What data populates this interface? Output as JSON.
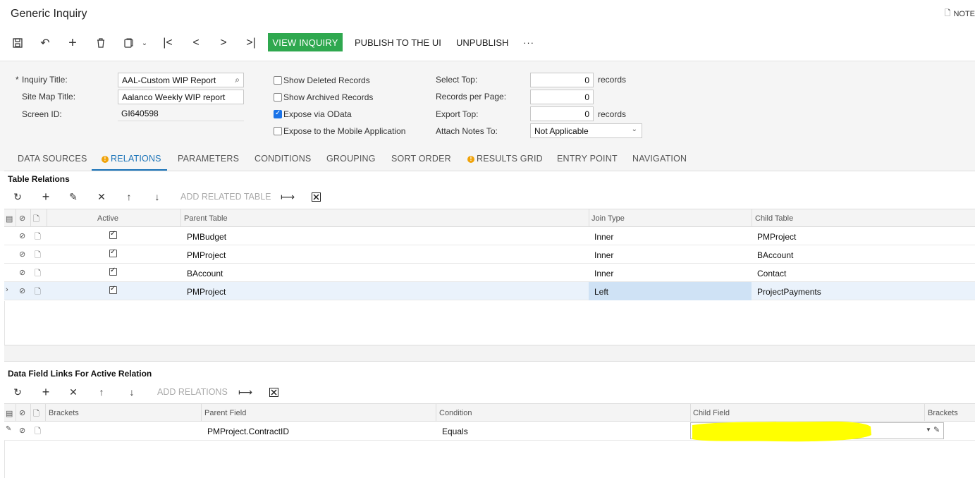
{
  "header": {
    "title": "Generic Inquiry",
    "notes_label": "NOTE"
  },
  "toolbar": {
    "view_inquiry": "VIEW INQUIRY",
    "publish": "PUBLISH TO THE UI",
    "unpublish": "UNPUBLISH",
    "more": "···"
  },
  "form": {
    "inquiry_title_label": "Inquiry Title:",
    "inquiry_title_required": "*",
    "inquiry_title_value": "AAL-Custom WIP Report",
    "site_map_title_label": "Site Map Title:",
    "site_map_title_value": "Aalanco Weekly WIP report",
    "screen_id_label": "Screen ID:",
    "screen_id_value": "GI640598",
    "show_deleted": "Show Deleted Records",
    "show_archived": "Show Archived Records",
    "expose_odata": "Expose via OData",
    "expose_mobile": "Expose to the Mobile Application",
    "select_top_label": "Select Top:",
    "select_top_value": "0",
    "records_per_page_label": "Records per Page:",
    "records_per_page_value": "0",
    "export_top_label": "Export Top:",
    "export_top_value": "0",
    "records_unit": "records",
    "attach_notes_label": "Attach Notes To:",
    "attach_notes_value": "Not Applicable"
  },
  "tabs": [
    "DATA SOURCES",
    "RELATIONS",
    "PARAMETERS",
    "CONDITIONS",
    "GROUPING",
    "SORT ORDER",
    "RESULTS GRID",
    "ENTRY POINT",
    "NAVIGATION"
  ],
  "relations": {
    "title": "Table Relations",
    "add_related": "ADD RELATED TABLE",
    "columns": {
      "active": "Active",
      "parent": "Parent Table",
      "join": "Join Type",
      "child": "Child Table"
    },
    "rows": [
      {
        "parent": "PMBudget",
        "join": "Inner",
        "child": "PMProject"
      },
      {
        "parent": "PMProject",
        "join": "Inner",
        "child": "BAccount"
      },
      {
        "parent": "BAccount",
        "join": "Inner",
        "child": "Contact"
      },
      {
        "parent": "PMProject",
        "join": "Left",
        "child": "ProjectPayments"
      }
    ]
  },
  "links": {
    "title": "Data Field Links For Active Relation",
    "add_relations": "ADD RELATIONS",
    "columns": {
      "brackets": "Brackets",
      "parent": "Parent Field",
      "condition": "Condition",
      "child": "Child Field",
      "brackets2": "Brackets"
    },
    "rows": [
      {
        "parent": "PMProject.ContractID",
        "condition": "Equals"
      }
    ]
  },
  "colors": {
    "accent_green": "#2fa84f",
    "tab_active": "#1a73b8",
    "highlight": "#ffff00"
  }
}
